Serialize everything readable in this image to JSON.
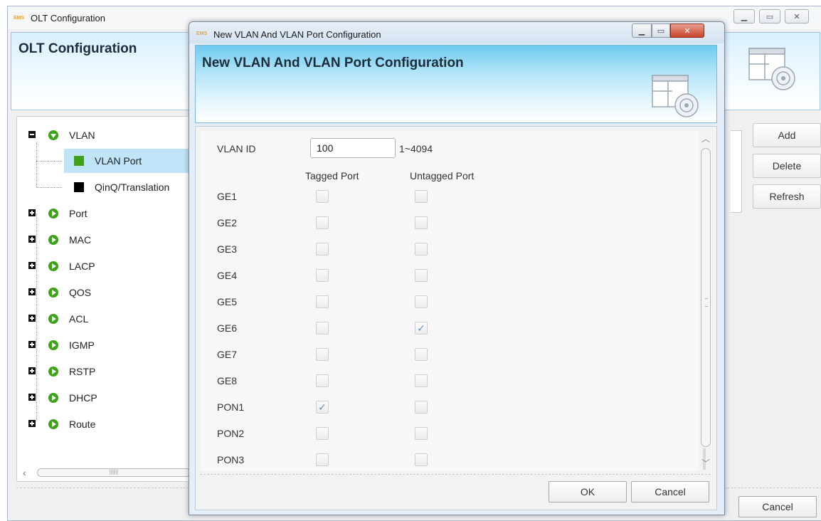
{
  "parent_window": {
    "title": "OLT Configuration",
    "app_icon_text": "EMS",
    "header_title": "OLT Configuration",
    "buttons": {
      "add": "Add",
      "delete": "Delete",
      "refresh": "Refresh",
      "cancel": "Cancel"
    }
  },
  "tree": {
    "items": [
      {
        "label": "VLAN",
        "expanded": true
      },
      {
        "label": "VLAN Port",
        "selected": true,
        "color": "#3ea11a"
      },
      {
        "label": "QinQ/Translation",
        "color": "#000000"
      },
      {
        "label": "Port"
      },
      {
        "label": "MAC"
      },
      {
        "label": "LACP"
      },
      {
        "label": "QOS"
      },
      {
        "label": "ACL"
      },
      {
        "label": "IGMP"
      },
      {
        "label": "RSTP"
      },
      {
        "label": "DHCP"
      },
      {
        "label": "Route"
      }
    ]
  },
  "dialog": {
    "title": "New VLAN And VLAN Port Configuration",
    "app_icon_text": "EMS",
    "header_title": "New VLAN And VLAN Port Configuration",
    "vlan_id_label": "VLAN ID",
    "vlan_id_value": "100",
    "vlan_id_range": "1~4094",
    "col_tagged": "Tagged Port",
    "col_untagged": "Untagged Port",
    "ports": [
      {
        "name": "GE1",
        "tagged": false,
        "untagged": false
      },
      {
        "name": "GE2",
        "tagged": false,
        "untagged": false
      },
      {
        "name": "GE3",
        "tagged": false,
        "untagged": false
      },
      {
        "name": "GE4",
        "tagged": false,
        "untagged": false
      },
      {
        "name": "GE5",
        "tagged": false,
        "untagged": false
      },
      {
        "name": "GE6",
        "tagged": false,
        "untagged": true
      },
      {
        "name": "GE7",
        "tagged": false,
        "untagged": false
      },
      {
        "name": "GE8",
        "tagged": false,
        "untagged": false
      },
      {
        "name": "PON1",
        "tagged": true,
        "untagged": false
      },
      {
        "name": "PON2",
        "tagged": false,
        "untagged": false
      },
      {
        "name": "PON3",
        "tagged": false,
        "untagged": false
      }
    ],
    "ok_label": "OK",
    "cancel_label": "Cancel"
  },
  "colors": {
    "accent_header": "#6dcbf1",
    "selection": "#bfe3f7",
    "tree_icon": "#3ea11a",
    "check": "#6a8fb8"
  }
}
